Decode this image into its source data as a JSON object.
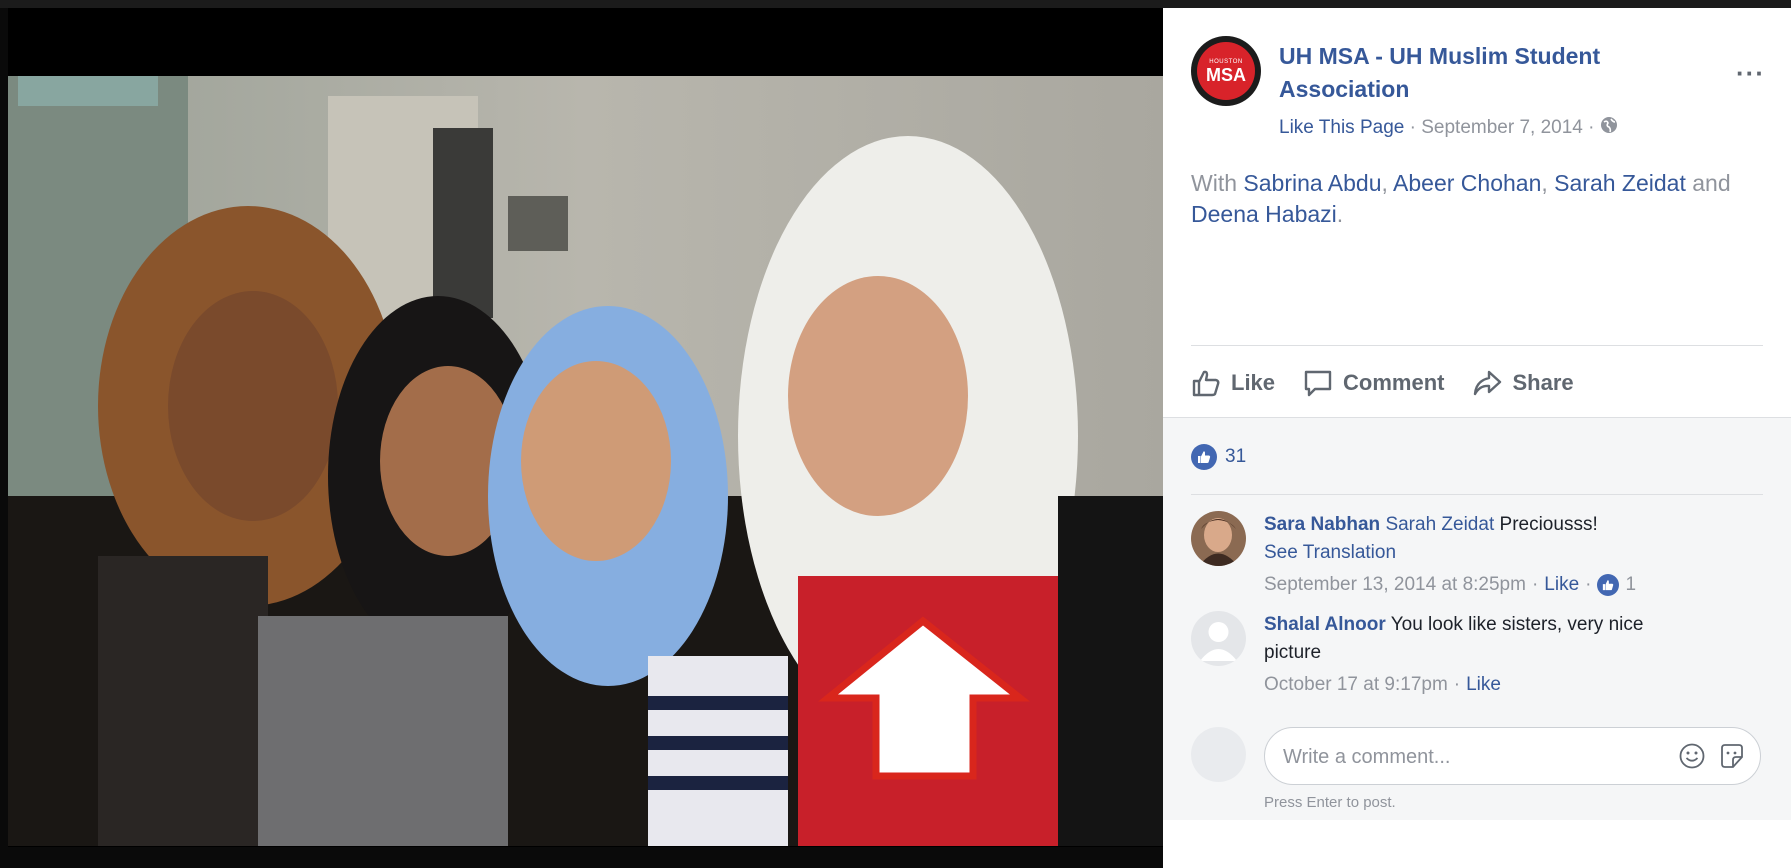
{
  "post": {
    "page_name": "UH MSA - UH Muslim Student Association",
    "avatar_small": "HOUSTON",
    "avatar_big": "MSA",
    "like_page": "Like This Page",
    "separator": " · ",
    "date": "September 7, 2014",
    "more": "···",
    "tag_prefix": "With",
    "tagged": [
      "Sabrina Abdu",
      "Abeer Chohan",
      "Sarah Zeidat",
      "Deena Habazi"
    ],
    "tag_sep1": ",",
    "tag_sep2": ",",
    "tag_and": "and",
    "tag_end": "."
  },
  "actions": {
    "like": "Like",
    "comment": "Comment",
    "share": "Share"
  },
  "reactions": {
    "count": "31"
  },
  "comments": [
    {
      "author": "Sara Nabhan",
      "mention": "Sarah Zeidat",
      "text": "Preciousss!",
      "see_translation": "See Translation",
      "time": "September 13, 2014 at 8:25pm",
      "like": "Like",
      "likes": "1"
    },
    {
      "author": "Shalal Alnoor",
      "text": "You look like sisters, very nice picture",
      "time": "October 17 at 9:17pm",
      "like": "Like"
    }
  ],
  "composer": {
    "placeholder": "Write a comment...",
    "hint": "Press Enter to post."
  },
  "colors": {
    "link": "#365899",
    "muted": "#90949c",
    "brand_red": "#d8232a",
    "like_blue": "#4267b2",
    "annotation_arrow": "#d9261c"
  }
}
